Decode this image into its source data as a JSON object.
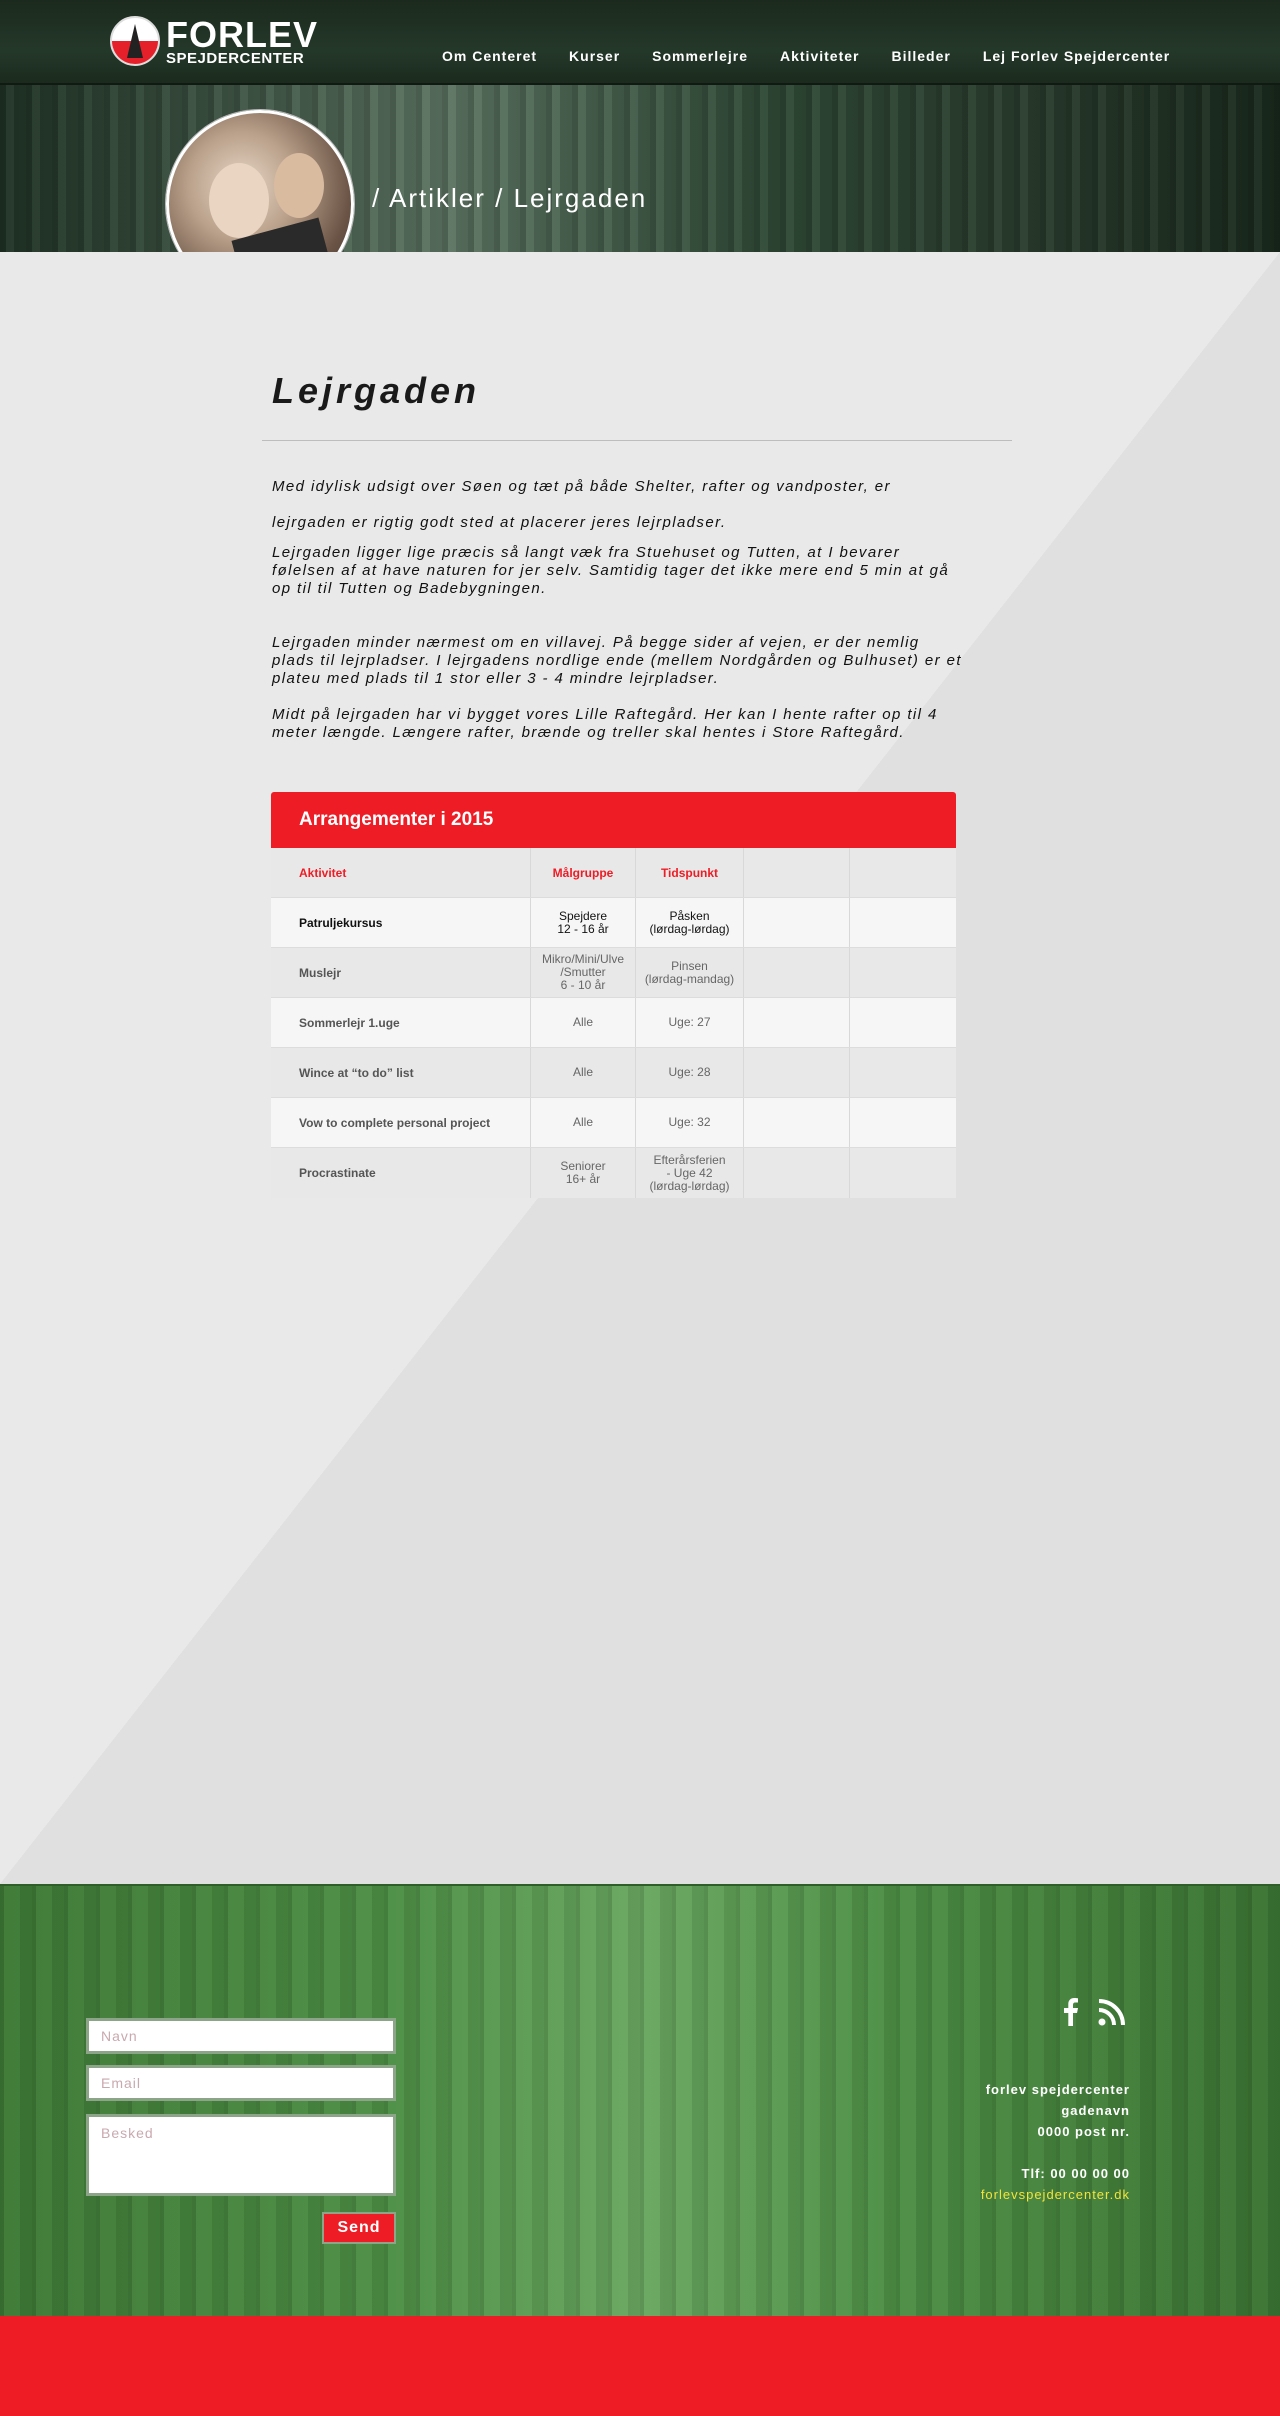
{
  "brand": {
    "name": "FORLEV",
    "sub": "SPEJDERCENTER"
  },
  "nav": [
    "Om Centeret",
    "Kurser",
    "Sommerlejre",
    "Aktiviteter",
    "Billeder",
    "Lej Forlev Spejdercenter"
  ],
  "hero": {
    "breadcrumb": "/ Artikler / Lejrgaden"
  },
  "article": {
    "title": "Lejrgaden",
    "p1a": "Med idylisk udsigt over Søen og tæt på både Shelter, rafter og vandposter, er",
    "p1b": "lejrgaden er rigtig godt sted at placerer jeres lejrpladser.",
    "p2": "Lejrgaden ligger lige præcis så langt væk fra Stuehuset og Tutten, at I bevarer følelsen af at have naturen for jer selv. Samtidig tager det ikke mere end 5 min at gå op til til Tutten og Badebygningen.",
    "p3": "Lejrgaden minder nærmest om en villavej. På begge sider af vejen, er der nemlig plads til lejrpladser. I lejrgadens nordlige ende (mellem Nordgården og Bulhuset) er et plateu med plads til 1 stor eller 3 - 4 mindre lejrpladser.",
    "p4": "Midt på lejrgaden har vi bygget vores Lille Raftegård. Her kan I hente rafter op til 4 meter længde. Længere rafter, brænde og treller skal hentes i Store Raftegård."
  },
  "events": {
    "title": "Arrangementer i 2015",
    "headers": [
      "Aktivitet",
      "Målgruppe",
      "Tidspunkt"
    ],
    "rows": [
      {
        "activity": "Patruljekursus",
        "group": "Spejdere\n12 - 16 år",
        "time": "Påsken\n(lørdag-lørdag)"
      },
      {
        "activity": "Muslejr",
        "group": "Mikro/Mini/Ulve\n/Smutter\n6 - 10 år",
        "time": "Pinsen\n(lørdag-mandag)"
      },
      {
        "activity": "Sommerlejr 1.uge",
        "group": "Alle",
        "time": "Uge: 27"
      },
      {
        "activity": "Wince at “to do” list",
        "group": "Alle",
        "time": "Uge: 28"
      },
      {
        "activity": "Vow to complete personal project",
        "group": "Alle",
        "time": "Uge: 32"
      },
      {
        "activity": "Procrastinate",
        "group": "Seniorer\n16+ år",
        "time": "Efterårsferien\n- Uge 42\n(lørdag-lørdag)"
      }
    ]
  },
  "form": {
    "name_placeholder": "Navn",
    "email_placeholder": "Email",
    "message_placeholder": "Besked",
    "send_label": "Send"
  },
  "contact": {
    "org": "forlev spejdercenter",
    "street": "gadenavn",
    "post": "0000 post nr.",
    "phone": "Tlf: 00 00 00 00",
    "web": "forlevspejdercenter.dk"
  },
  "icons": [
    "facebook-icon",
    "rss-icon"
  ],
  "colors": {
    "accent": "#ee1c25",
    "footer_green": "#4d8f45",
    "link_yellow": "#f3e33b"
  }
}
